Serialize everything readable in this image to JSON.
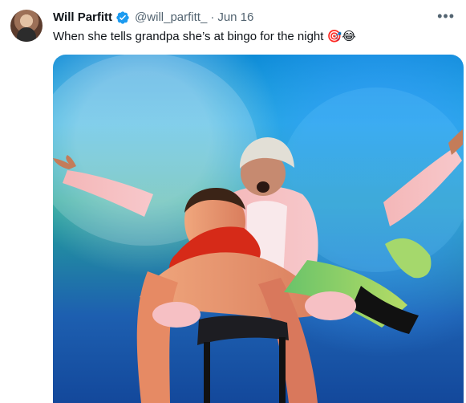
{
  "tweet": {
    "display_name": "Will Parfitt",
    "handle": "@will_parfitt_",
    "separator": "·",
    "date": "Jun 16",
    "more_label": "•••",
    "text": "When she tells grandpa she’s at bingo for the night 🎯😂"
  },
  "icons": {
    "avatar": "profile-avatar",
    "verified": "verified-badge-icon",
    "more": "more-options-icon"
  },
  "colors": {
    "verified_blue": "#1d9bf0",
    "secondary_text": "#536471",
    "primary_text": "#0f1419"
  }
}
